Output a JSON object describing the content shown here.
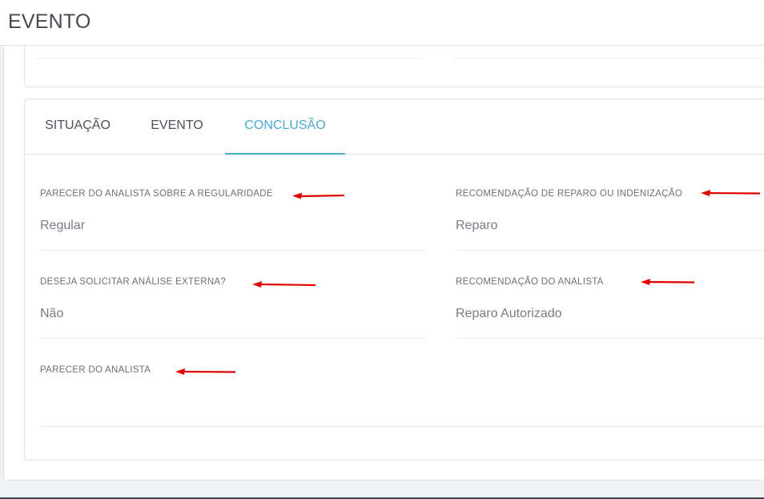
{
  "header": {
    "title": "EVENTO"
  },
  "tabs": [
    {
      "label": "SITUAÇÃO",
      "active": false
    },
    {
      "label": "EVENTO",
      "active": false
    },
    {
      "label": "CONCLUSÃO",
      "active": true
    }
  ],
  "fields": {
    "parecer_regularidade": {
      "label": "PARECER DO ANALISTA SOBRE A REGULARIDADE",
      "value": "Regular"
    },
    "recomendacao_reparo": {
      "label": "RECOMENDAÇÃO DE REPARO OU INDENIZAÇÃO",
      "value": "Reparo"
    },
    "analise_externa": {
      "label": "DESEJA SOLICITAR ANÁLISE EXTERNA?",
      "value": "Não"
    },
    "recomendacao_analista": {
      "label": "RECOMENDAÇÃO DO ANALISTA",
      "value": "Reparo Autorizado"
    },
    "parecer_analista": {
      "label": "PARECER DO ANALISTA",
      "value": ""
    }
  },
  "colors": {
    "accent": "#4aa9d1",
    "annotation_arrow": "#e00000"
  }
}
